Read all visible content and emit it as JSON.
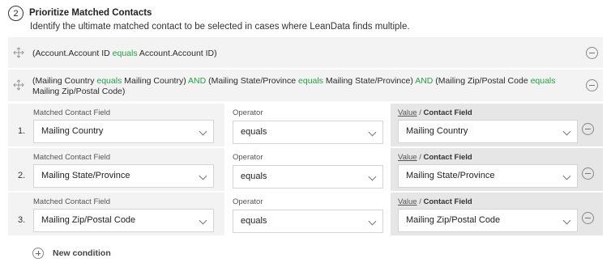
{
  "step": {
    "number": "2",
    "title": "Prioritize Matched Contacts",
    "description": "Identify the ultimate matched contact to be selected in cases where LeanData finds multiple."
  },
  "rules": [
    {
      "parts": [
        {
          "text": "(Account.Account ID ",
          "kw": false
        },
        {
          "text": "equals",
          "kw": true
        },
        {
          "text": " Account.Account ID)",
          "kw": false
        }
      ]
    },
    {
      "parts": [
        {
          "text": "(Mailing Country ",
          "kw": false
        },
        {
          "text": "equals",
          "kw": true
        },
        {
          "text": " Mailing Country) ",
          "kw": false
        },
        {
          "text": "AND",
          "kw": true
        },
        {
          "text": " (Mailing State/Province ",
          "kw": false
        },
        {
          "text": "equals",
          "kw": true
        },
        {
          "text": " Mailing State/Province) ",
          "kw": false
        },
        {
          "text": "AND",
          "kw": true
        },
        {
          "text": " (Mailing Zip/Postal Code ",
          "kw": false
        },
        {
          "text": "equals",
          "kw": true
        },
        {
          "text": " Mailing Zip/Postal Code)",
          "kw": false
        }
      ]
    }
  ],
  "labels": {
    "matched_field": "Matched Contact Field",
    "operator": "Operator",
    "value": "Value",
    "separator": " / ",
    "contact_field": "Contact Field"
  },
  "conditions": [
    {
      "num": "1.",
      "field": "Mailing Country",
      "operator": "equals",
      "value": "Mailing Country"
    },
    {
      "num": "2.",
      "field": "Mailing State/Province",
      "operator": "equals",
      "value": "Mailing State/Province"
    },
    {
      "num": "3.",
      "field": "Mailing Zip/Postal Code",
      "operator": "equals",
      "value": "Mailing Zip/Postal Code"
    }
  ],
  "new_condition": "New condition",
  "colors": {
    "keyword": "#22a046",
    "panel": "#f3f3f3",
    "value_panel": "#e6e6e6"
  }
}
